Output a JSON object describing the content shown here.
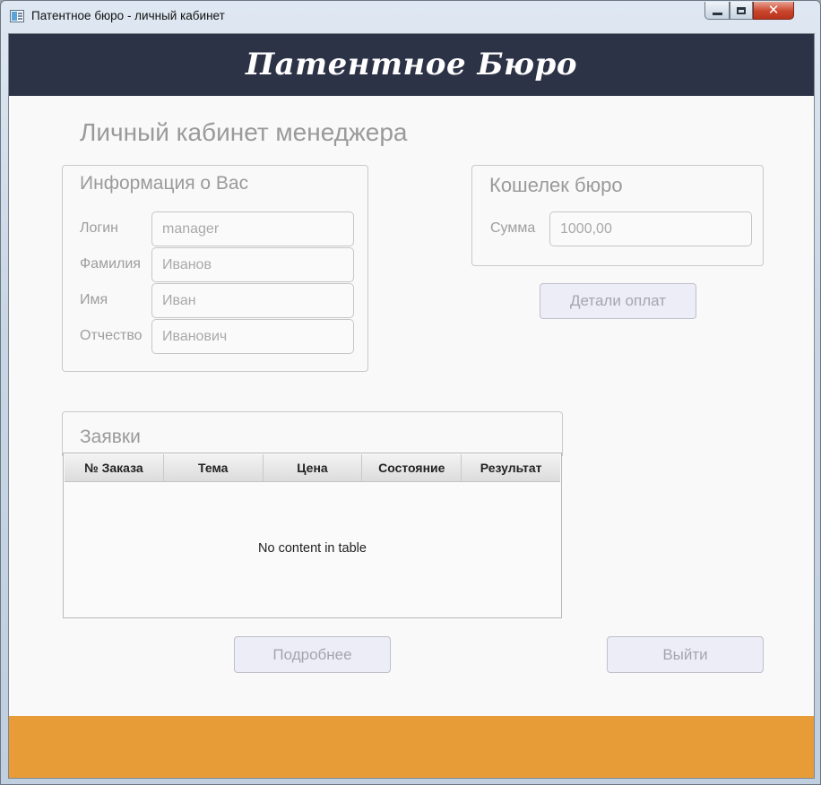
{
  "window": {
    "title": "Патентное бюро - личный кабинет",
    "icon": "app-window-icon",
    "controls": {
      "minimize": "minimize-icon",
      "maximize": "maximize-icon",
      "close": "✕"
    }
  },
  "header": {
    "brand": "Патентное Бюро"
  },
  "page": {
    "title": "Личный кабинет менеджера"
  },
  "info_panel": {
    "title": "Информация о Вас",
    "fields": [
      {
        "label": "Логин",
        "value": "manager"
      },
      {
        "label": "Фамилия",
        "value": "Иванов"
      },
      {
        "label": "Имя",
        "value": "Иван"
      },
      {
        "label": "Отчество",
        "value": "Иванович"
      }
    ]
  },
  "wallet_panel": {
    "title": "Кошелек бюро",
    "sum_label": "Сумма",
    "sum_value": "1000,00",
    "details_button": "Детали оплат"
  },
  "orders_panel": {
    "title": "Заявки",
    "columns": [
      "№ Заказа",
      "Тема",
      "Цена",
      "Состояние",
      "Результат"
    ],
    "rows": [],
    "empty_message": "No content in table"
  },
  "actions": {
    "details_button": "Подробнее",
    "logout_button": "Выйти"
  },
  "colors": {
    "header_bg": "#2d3347",
    "footer_bg": "#e89c38",
    "content_bg": "#f9f9f9"
  }
}
